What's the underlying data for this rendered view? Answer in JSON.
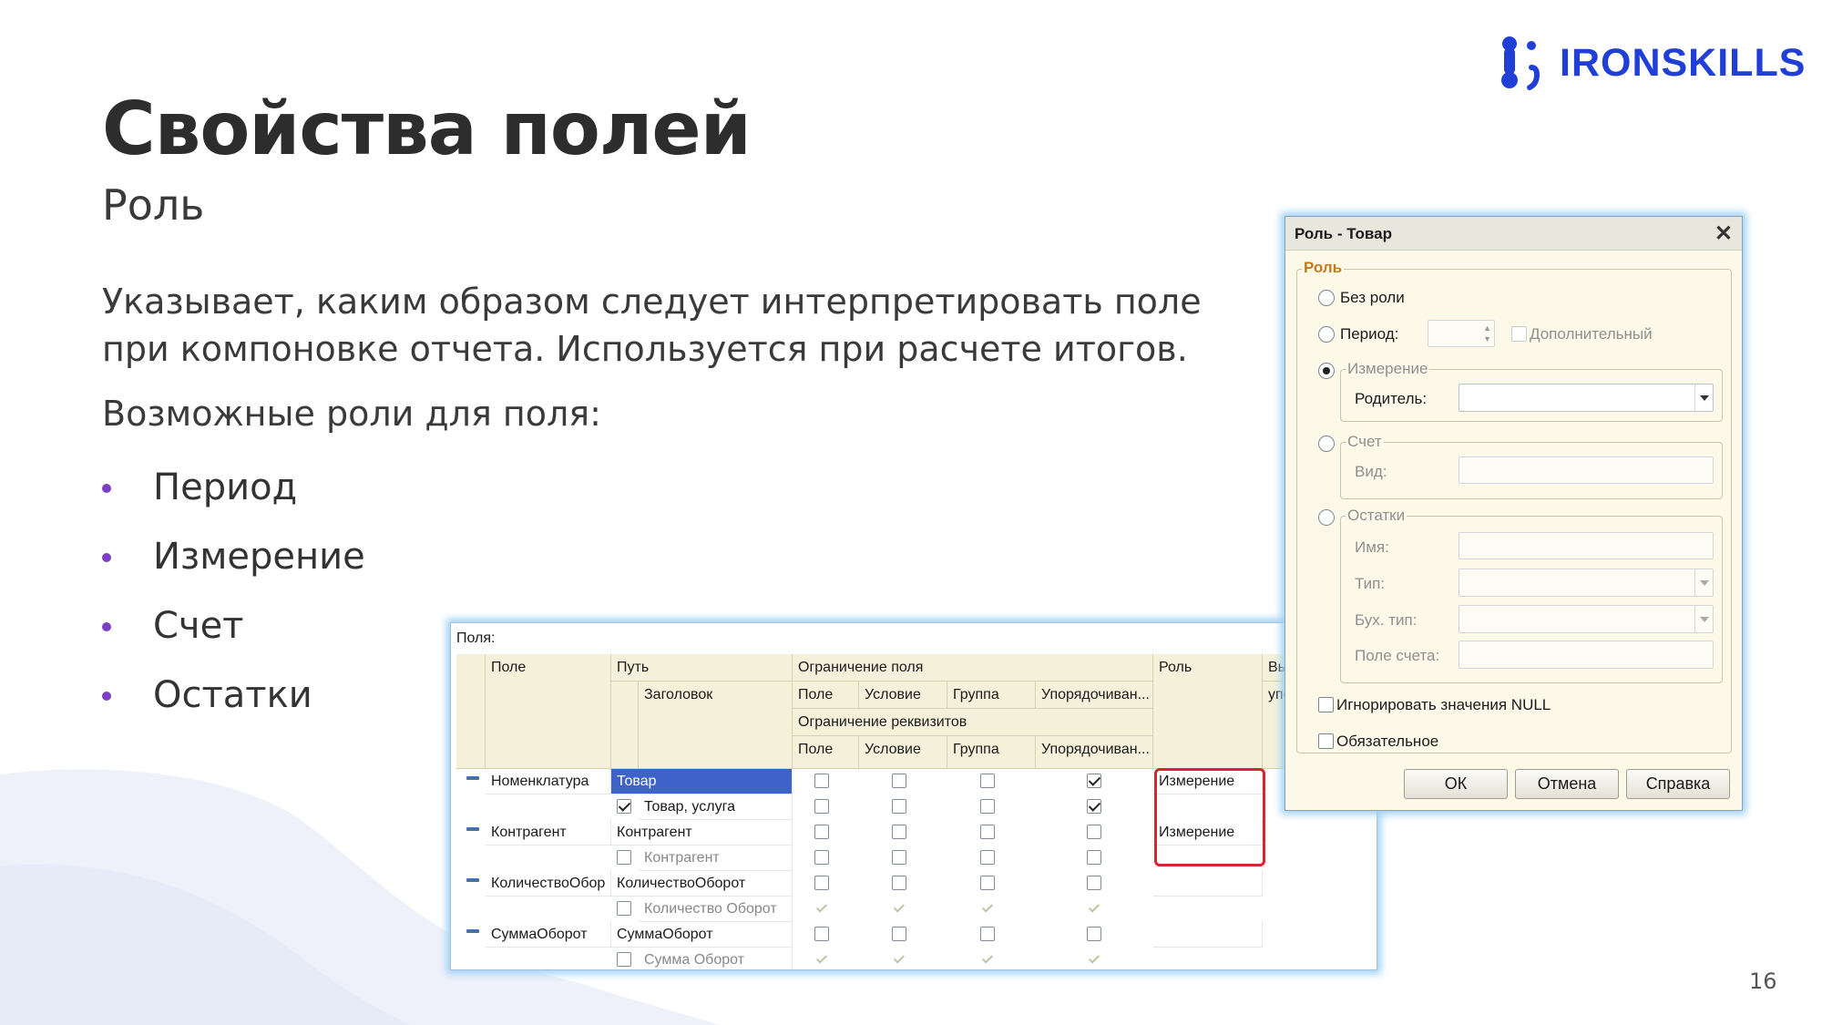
{
  "slide": {
    "title": "Свойства полей",
    "subtitle": "Роль",
    "description": "Указывает, каким образом следует интерпретировать поле при компоновке отчета. Используется при расчете итогов.",
    "roles_intro": "Возможные роли для поля:",
    "roles": [
      "Период",
      "Измерение",
      "Счет",
      "Остатки"
    ],
    "page_number": "16",
    "logo_text": "IRONSKILLS",
    "accent_color": "#7b3fc4",
    "logo_color": "#1f3fd6"
  },
  "grid": {
    "caption": "Поля:",
    "headers": {
      "field": "Поле",
      "path": "Путь",
      "heading": "Заголовок",
      "field_restriction": "Ограничение поля",
      "attr_restriction": "Ограничение реквизитов",
      "sub_field": "Поле",
      "sub_condition": "Условие",
      "sub_group": "Группа",
      "sub_order": "Упорядочиван...",
      "role": "Роль",
      "expr_1": "Вы",
      "expr_2": "упо"
    },
    "rows": [
      {
        "field": "Номенклатура",
        "path": "Товар",
        "heading": "Товар, услуга",
        "role": "Измерение"
      },
      {
        "field": "Контрагент",
        "path": "Контрагент",
        "heading": "Контрагент",
        "role": "Измерение"
      },
      {
        "field": "КоличествоОбор",
        "path": "КоличествоОборот",
        "heading": "Количество Оборот",
        "role": ""
      },
      {
        "field": "СуммаОборот",
        "path": "СуммаОборот",
        "heading": "Сумма Оборот",
        "role": ""
      }
    ]
  },
  "dialog": {
    "title": "Роль - Товар",
    "close": "✕",
    "group_role": "Роль",
    "opt_none": "Без роли",
    "opt_period": "Период:",
    "chk_additional": "Дополнительный",
    "grp_dimension": "Измерение",
    "lbl_parent": "Родитель:",
    "grp_account": "Счет",
    "lbl_kind": "Вид:",
    "grp_balance": "Остатки",
    "lbl_name": "Имя:",
    "lbl_type": "Тип:",
    "lbl_acc_type": "Бух. тип:",
    "lbl_acc_field": "Поле счета:",
    "chk_ignore_null": "Игнорировать значения NULL",
    "chk_required": "Обязательное",
    "btn_ok": "ОК",
    "btn_cancel": "Отмена",
    "btn_help": "Справка",
    "selected_option": "Измерение"
  }
}
